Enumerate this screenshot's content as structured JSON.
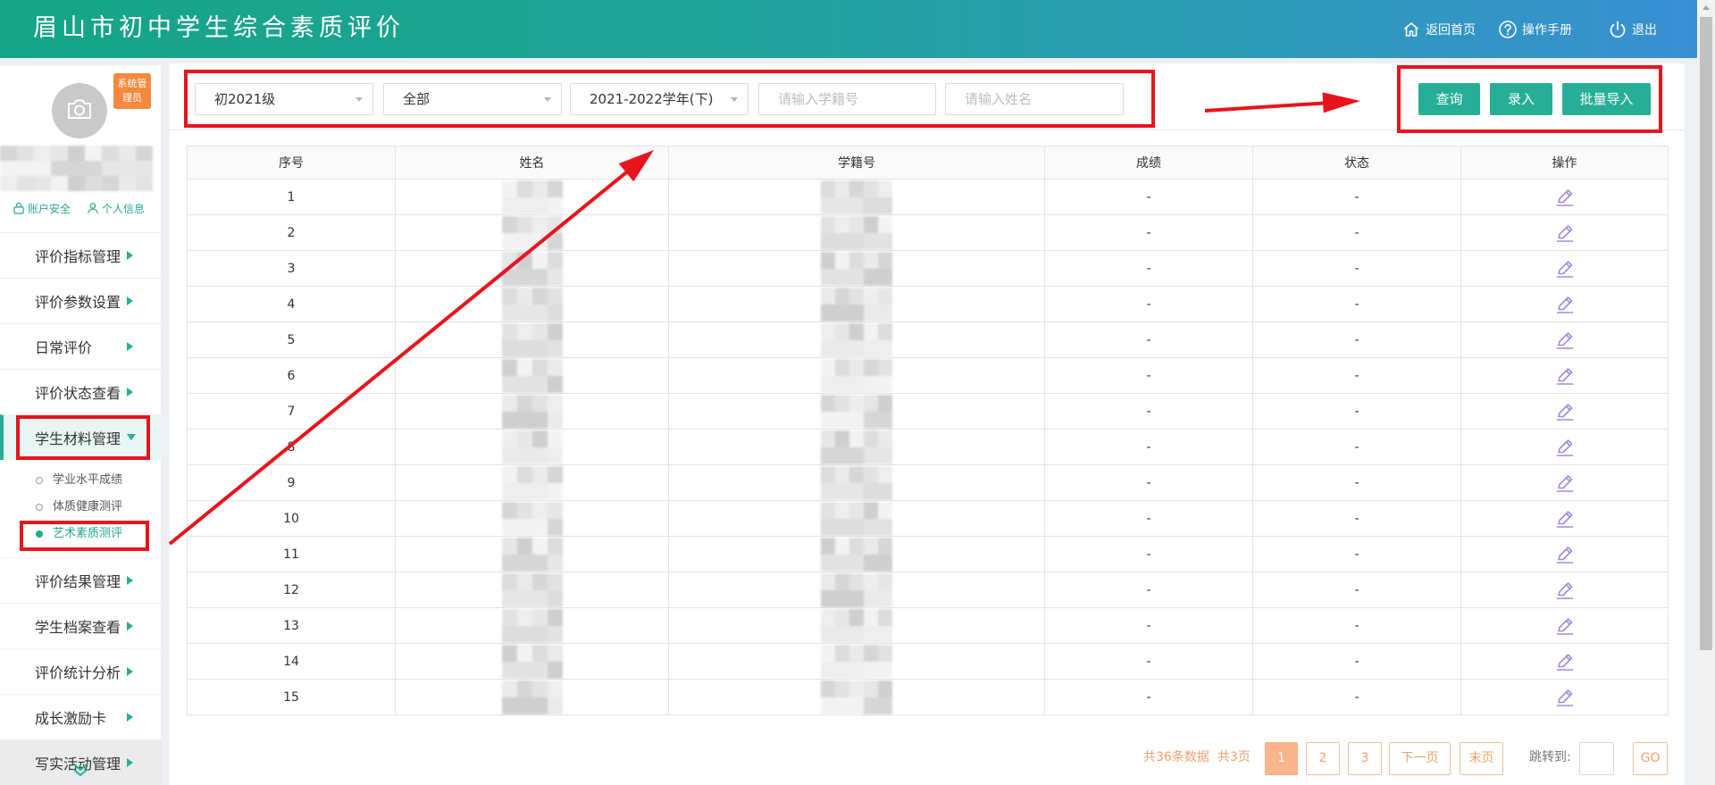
{
  "header": {
    "title": "眉山市初中学生综合素质评价",
    "links": [
      {
        "label": "返回首页",
        "icon": "home-icon"
      },
      {
        "label": "操作手册",
        "icon": "help-icon"
      },
      {
        "label": "退出",
        "icon": "power-icon"
      }
    ]
  },
  "user": {
    "role_badge": "系统管理员",
    "account_security": "账户安全",
    "profile": "个人信息",
    "avatar_icon": "camera-icon"
  },
  "sidebar": {
    "items": [
      {
        "label": "评价指标管理"
      },
      {
        "label": "评价参数设置"
      },
      {
        "label": "日常评价"
      },
      {
        "label": "评价状态查看"
      },
      {
        "label": "学生材料管理",
        "active": true,
        "expanded": true,
        "children": [
          {
            "label": "学业水平成绩",
            "active": false
          },
          {
            "label": "体质健康测评",
            "active": false
          },
          {
            "label": "艺术素质测评",
            "active": true
          }
        ]
      },
      {
        "label": "评价结果管理"
      },
      {
        "label": "学生档案查看"
      },
      {
        "label": "评价统计分析"
      },
      {
        "label": "成长激励卡"
      },
      {
        "label": "写实活动管理",
        "hovered": true
      }
    ]
  },
  "filters": {
    "grade": {
      "value": "初2021级"
    },
    "category": {
      "value": "全部"
    },
    "term": {
      "value": "2021-2022学年(下)"
    },
    "student_id": {
      "placeholder": "请输入学籍号"
    },
    "name": {
      "placeholder": "请输入姓名"
    }
  },
  "actions": {
    "query": "查询",
    "enter": "录入",
    "batch_import": "批量导入"
  },
  "table": {
    "columns": [
      "序号",
      "姓名",
      "学籍号",
      "成绩",
      "状态",
      "操作"
    ],
    "rows": [
      {
        "index": "1",
        "score": "-",
        "status": "-",
        "action_icon": "edit-icon"
      },
      {
        "index": "2",
        "score": "-",
        "status": "-",
        "action_icon": "edit-icon"
      },
      {
        "index": "3",
        "score": "-",
        "status": "-",
        "action_icon": "edit-icon"
      },
      {
        "index": "4",
        "score": "-",
        "status": "-",
        "action_icon": "edit-icon"
      },
      {
        "index": "5",
        "score": "-",
        "status": "-",
        "action_icon": "edit-icon"
      },
      {
        "index": "6",
        "score": "-",
        "status": "-",
        "action_icon": "edit-icon"
      },
      {
        "index": "7",
        "score": "-",
        "status": "-",
        "action_icon": "edit-icon"
      },
      {
        "index": "8",
        "score": "-",
        "status": "-",
        "action_icon": "edit-icon"
      },
      {
        "index": "9",
        "score": "-",
        "status": "-",
        "action_icon": "edit-icon"
      },
      {
        "index": "10",
        "score": "-",
        "status": "-",
        "action_icon": "edit-icon"
      },
      {
        "index": "11",
        "score": "-",
        "status": "-",
        "action_icon": "edit-icon"
      },
      {
        "index": "12",
        "score": "-",
        "status": "-",
        "action_icon": "edit-icon"
      },
      {
        "index": "13",
        "score": "-",
        "status": "-",
        "action_icon": "edit-icon"
      },
      {
        "index": "14",
        "score": "-",
        "status": "-",
        "action_icon": "edit-icon"
      },
      {
        "index": "15",
        "score": "-",
        "status": "-",
        "action_icon": "edit-icon"
      }
    ]
  },
  "pagination": {
    "total": "共36条数据",
    "page_count": "共3页",
    "pages": [
      {
        "label": "1",
        "active": true
      },
      {
        "label": "2",
        "active": false
      },
      {
        "label": "3",
        "active": false
      }
    ],
    "next": "下一页",
    "last": "末页",
    "jump_label": "跳转到:",
    "go": "GO"
  },
  "colors": {
    "header_start": "#14a487",
    "header_end": "#3a8fd3",
    "primary": "#27ae96",
    "badge_orange": "#f5893d",
    "pagination_orange": "#f4a06b",
    "edit_icon": "#a48ad8",
    "annotation_red": "#e8141b"
  }
}
